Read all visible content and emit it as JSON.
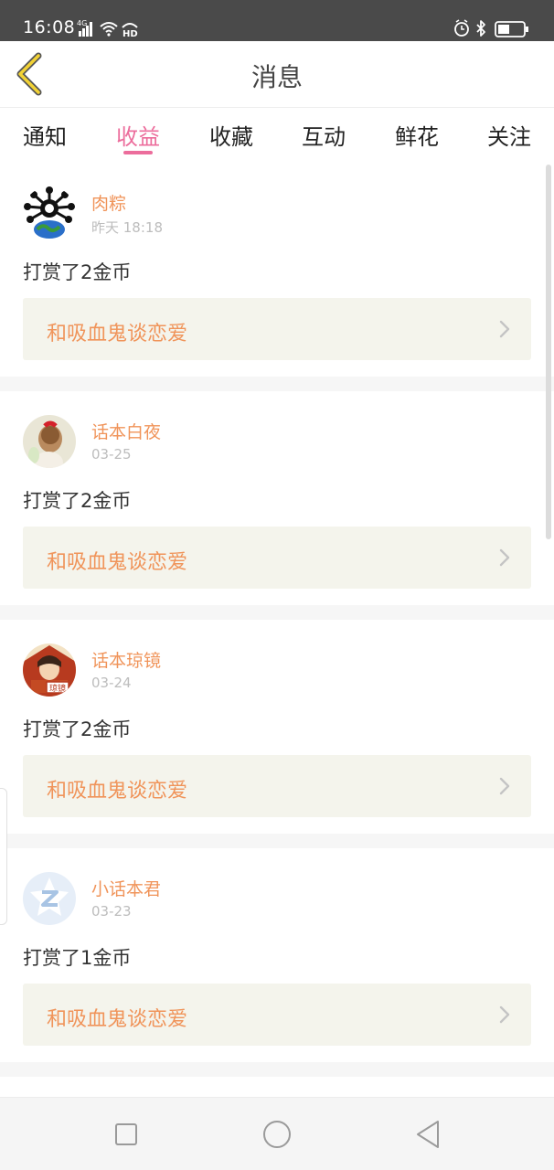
{
  "status_bar": {
    "time": "16:08",
    "network": "4G",
    "network_hd": "HD",
    "battery_level": 0.45
  },
  "header": {
    "title": "消息"
  },
  "tabs": [
    {
      "label": "通知",
      "active": false
    },
    {
      "label": "收益",
      "active": true
    },
    {
      "label": "收藏",
      "active": false
    },
    {
      "label": "互动",
      "active": false
    },
    {
      "label": "鲜花",
      "active": false
    },
    {
      "label": "关注",
      "active": false
    }
  ],
  "messages": [
    {
      "user": "肉粽",
      "time": "昨天 18:18",
      "action": "打赏了2金币",
      "book": "和吸血鬼谈恋爱",
      "avatar": "virus-globe-avatar"
    },
    {
      "user": "话本白夜",
      "time": "03-25",
      "action": "打赏了2金币",
      "book": "和吸血鬼谈恋爱",
      "avatar": "girl-photo-avatar"
    },
    {
      "user": "话本琼镜",
      "time": "03-24",
      "action": "打赏了2金币",
      "book": "和吸血鬼谈恋爱",
      "avatar": "costume-character-avatar",
      "avatar_text": "琼镜"
    },
    {
      "user": "小话本君",
      "time": "03-23",
      "action": "打赏了1金币",
      "book": "和吸血鬼谈恋爱",
      "avatar": "default-z-avatar"
    }
  ],
  "colors": {
    "accent_pink": "#ec6d9c",
    "accent_orange": "#f0945a",
    "status_bar": "#4a4a4a",
    "book_box": "#f4f4ec"
  },
  "icons": {
    "back": "chevron-left-icon",
    "book_arrow": "chevron-right-icon",
    "nav_recents": "square-icon",
    "nav_home": "circle-icon",
    "nav_back": "triangle-left-icon"
  }
}
